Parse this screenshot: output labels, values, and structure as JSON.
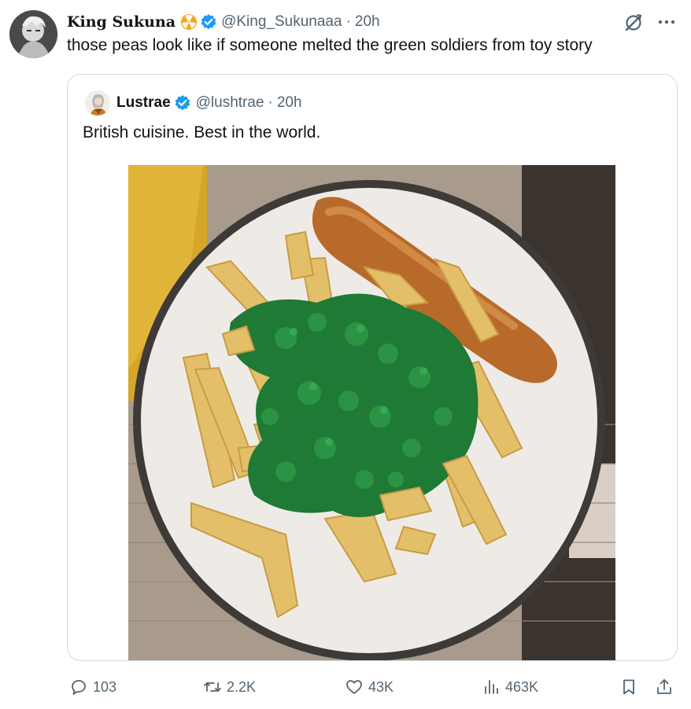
{
  "tweet": {
    "display_name": "King Sukuna",
    "handle": "@King_Sukunaaa",
    "separator": "·",
    "time": "20h",
    "text": "those peas look like if someone melted the green soldiers from toy story",
    "icons": {
      "badge": "radioactive-badge-icon",
      "verified": "verified-badge-icon",
      "grok": "grok-icon",
      "more": "more-options-icon"
    }
  },
  "quote": {
    "display_name": "Lustrae",
    "handle": "@lushtrae",
    "separator": "·",
    "time": "20h",
    "text": "British cuisine. Best in the world.",
    "image_alt": "photo of chips, mushy peas and a battered sausage on a plate"
  },
  "actions": {
    "replies": "103",
    "reposts": "2.2K",
    "likes": "43K",
    "views": "463K"
  },
  "colors": {
    "text_primary": "#0f1419",
    "text_secondary": "#536471",
    "verified_blue": "#1d9bf0",
    "border": "#cfd9de"
  }
}
